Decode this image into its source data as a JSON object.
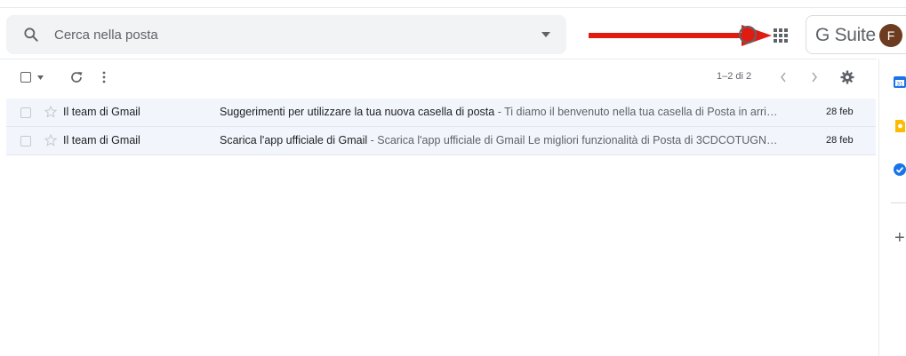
{
  "search": {
    "placeholder": "Cerca nella posta",
    "value": ""
  },
  "header": {
    "brand": "G Suite",
    "avatar_letter": "F",
    "icons": [
      "search-icon",
      "dropdown-caret-icon",
      "help-icon",
      "apps-grid-icon"
    ],
    "annotation_arrow_color": "#e01b12"
  },
  "toolbar": {
    "pager_text": "1–2 di 2"
  },
  "emails": [
    {
      "sender": "Il team di Gmail",
      "subject": "Suggerimenti per utilizzare la tua nuova casella di posta",
      "snippet": " - Ti diamo il benvenuto nella tua casella di Posta in arri…",
      "date": "28 feb"
    },
    {
      "sender": "Il team di Gmail",
      "subject": "Scarica l'app ufficiale di Gmail",
      "snippet": " - Scarica l'app ufficiale di Gmail Le migliori funzionalità di Posta di 3CDCOTUGN…",
      "date": "28 feb"
    }
  ],
  "side_panel": {
    "icons": [
      "calendar-icon",
      "keep-icon",
      "tasks-icon",
      "add-addon-icon"
    ],
    "plus": "+",
    "calendar_label": "31"
  },
  "colors": {
    "accent": "#1a73e8",
    "row_bg": "#f2f6fc",
    "avatar_bg": "#6d3b1f"
  }
}
